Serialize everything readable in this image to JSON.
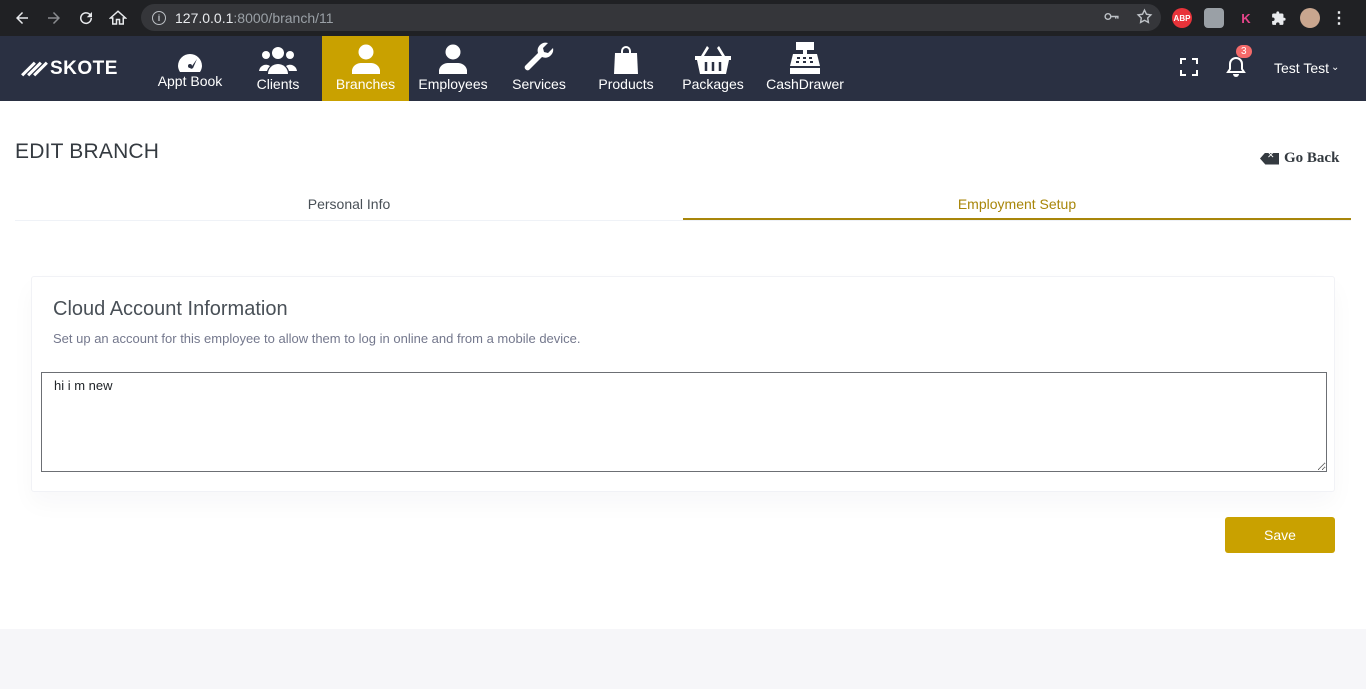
{
  "browser": {
    "url_host": "127.0.0.1",
    "url_path": ":8000/branch/11",
    "extensions": {
      "abp_label": "ABP",
      "k_label": "K"
    }
  },
  "header": {
    "brand": "SKOTE",
    "nav": [
      {
        "label": "Appt Book",
        "icon": "dashboard-gauge-icon"
      },
      {
        "label": "Clients",
        "icon": "users-icon"
      },
      {
        "label": "Branches",
        "icon": "user-icon",
        "active": true
      },
      {
        "label": "Employees",
        "icon": "user-icon"
      },
      {
        "label": "Services",
        "icon": "wrench-icon"
      },
      {
        "label": "Products",
        "icon": "shopping-bag-icon"
      },
      {
        "label": "Packages",
        "icon": "basket-icon"
      },
      {
        "label": "CashDrawer",
        "icon": "cash-register-icon"
      }
    ],
    "notification_count": "3",
    "user_name": "Test Test"
  },
  "page": {
    "title": "EDIT BRANCH",
    "go_back_label": "Go Back",
    "tabs": [
      {
        "label": "Personal Info",
        "active": false
      },
      {
        "label": "Employment Setup",
        "active": true
      }
    ],
    "card": {
      "title": "Cloud Account Information",
      "subtitle": "Set up an account for this employee to allow them to log in online and from a mobile device.",
      "textarea_value": "hi i m new"
    },
    "save_label": "Save"
  },
  "colors": {
    "accent": "#c9a100",
    "tab_active": "#a8860a",
    "header_bg": "#2a3042",
    "badge": "#f46a6a"
  }
}
